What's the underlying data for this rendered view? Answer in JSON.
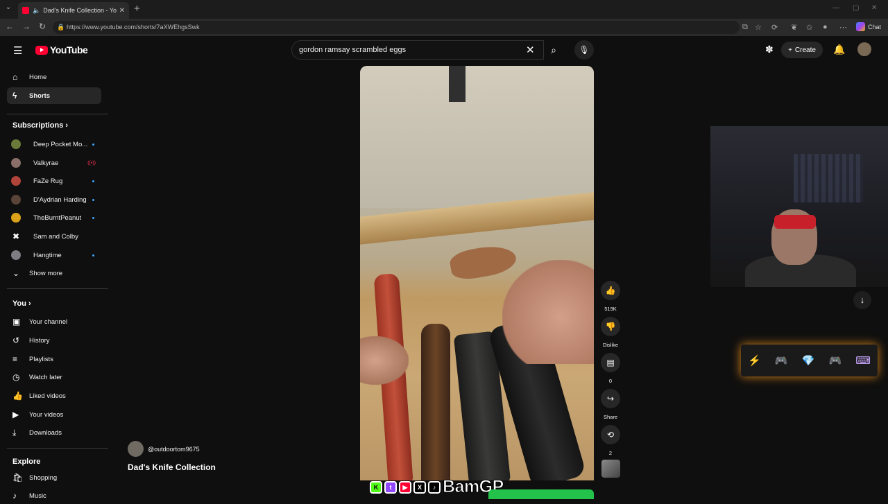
{
  "browser": {
    "tab_title": "Dad's Knife Collection - YouTube",
    "url": "https://www.youtube.com/shorts/7aXWEhgsSwk",
    "chat_label": "Chat"
  },
  "header": {
    "logo_text": "YouTube",
    "search_value": "gordon ramsay scrambled eggs",
    "create_label": "Create"
  },
  "sidebar": {
    "main": [
      {
        "label": "Home",
        "icon": "home-icon"
      },
      {
        "label": "Shorts",
        "icon": "shorts-icon"
      }
    ],
    "subscriptions_heading": "Subscriptions",
    "subscriptions": [
      {
        "label": "Deep Pocket Mo...",
        "color": "#6b7a3a",
        "status": "dot"
      },
      {
        "label": "Valkyrae",
        "color": "#8a6e6a",
        "status": "live"
      },
      {
        "label": "FaZe Rug",
        "color": "#b0433a",
        "status": "dot"
      },
      {
        "label": "D'Aydrian Harding",
        "color": "#5a4438",
        "status": "dot"
      },
      {
        "label": "TheBurntPeanut",
        "color": "#d9a21a",
        "status": "dot"
      },
      {
        "label": "Sam and Colby",
        "color": "#ffffff",
        "status": "none"
      },
      {
        "label": "Hangtime",
        "color": "#7d7d82",
        "status": "dot"
      }
    ],
    "show_more": "Show more",
    "you_heading": "You",
    "you": [
      {
        "label": "Your channel"
      },
      {
        "label": "History"
      },
      {
        "label": "Playlists"
      },
      {
        "label": "Watch later"
      },
      {
        "label": "Liked videos"
      },
      {
        "label": "Your videos"
      },
      {
        "label": "Downloads"
      }
    ],
    "explore_heading": "Explore",
    "explore": [
      {
        "label": "Shopping"
      },
      {
        "label": "Music"
      }
    ]
  },
  "short": {
    "channel": "@outdoortom9675",
    "title": "Dad's Knife Collection",
    "actions": [
      {
        "name": "like",
        "label": "519K"
      },
      {
        "name": "dislike",
        "label": "Dislike"
      },
      {
        "name": "comments",
        "label": "0"
      },
      {
        "name": "share",
        "label": "Share"
      },
      {
        "name": "remix",
        "label": "2"
      }
    ]
  },
  "overlay": {
    "streamer_name": "BamGP"
  },
  "colors": {
    "accent": "#ff0033",
    "subscription_dot": "#3ea6ff",
    "overlay_green": "#22c24b"
  }
}
